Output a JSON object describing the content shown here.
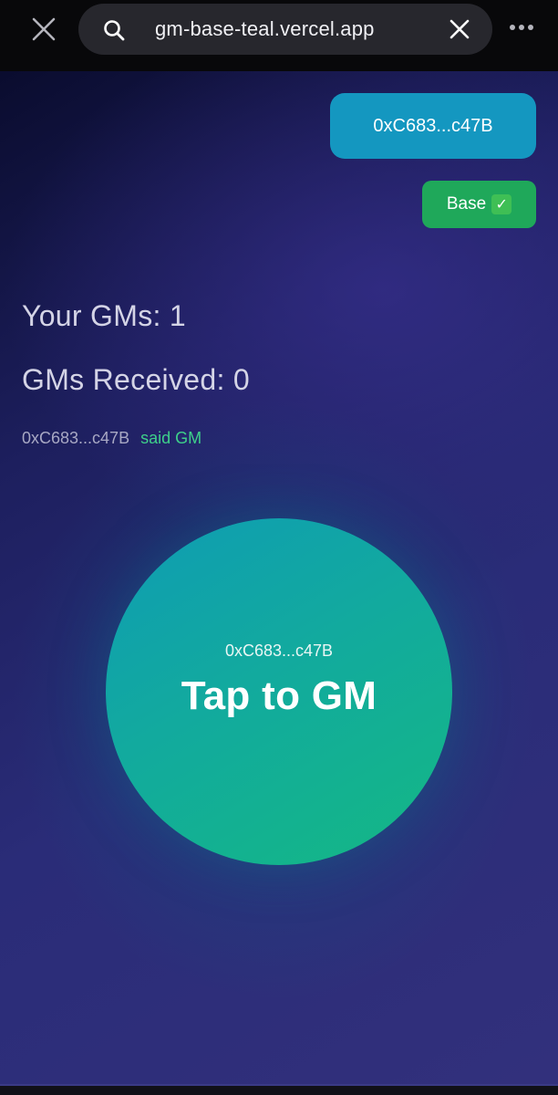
{
  "browser": {
    "url": "gm-base-teal.vercel.app",
    "icons": {
      "close": "close-icon",
      "search": "search-icon",
      "clear": "clear-icon",
      "more": "more-vertical-icon"
    }
  },
  "header": {
    "wallet_address": "0xC683...c47B",
    "network_label": "Base",
    "network_check": "✓"
  },
  "stats": {
    "your_gms": "Your GMs: 1",
    "gms_received": "GMs Received: 0"
  },
  "activity": {
    "address": "0xC683...c47B",
    "message": "said GM"
  },
  "gm_button": {
    "address": "0xC683...c47B",
    "label": "Tap to GM"
  },
  "colors": {
    "wallet_button": "#1497c0",
    "network_badge": "#1fa85a",
    "activity_message": "#3ed08a",
    "gm_circle_start": "#0f9cb4",
    "gm_circle_end": "#14b884"
  }
}
